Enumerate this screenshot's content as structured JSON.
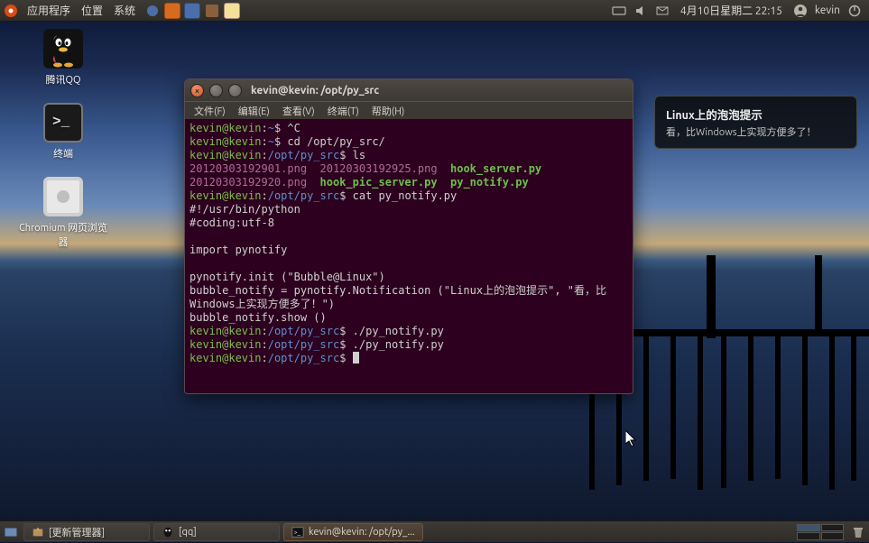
{
  "top_panel": {
    "menus": [
      "应用程序",
      "位置",
      "系统"
    ],
    "clock": "4月10日星期二 22:15",
    "user": "kevin"
  },
  "desktop_icons": {
    "qq": "腾讯QQ",
    "terminal": "终端",
    "chromium": "Chromium 网页浏览器"
  },
  "terminal": {
    "title": "kevin@kevin: /opt/py_src",
    "menus": [
      "文件(F)",
      "编辑(E)",
      "查看(V)",
      "终端(T)",
      "帮助(H)"
    ],
    "l1_user": "kevin@kevin",
    "l1_path": "~",
    "l1_cmd": "^C",
    "l2_cmd": "cd /opt/py_src/",
    "l3_path": "/opt/py_src",
    "l3_cmd": "ls",
    "ls_png1": "20120303192901.png",
    "ls_png2": "20120303192925.png",
    "ls_exe1": "hook_server.py",
    "ls_png3": "20120303192920.png",
    "ls_exe2": "hook_pic_server.py",
    "ls_exe3": "py_notify.py",
    "l4_cmd": "cat py_notify.py",
    "src1": "#!/usr/bin/python",
    "src2": "#coding:utf-8",
    "src3": "",
    "src4": "import pynotify",
    "src5": "",
    "src6": "pynotify.init (\"Bubble@Linux\")",
    "src7": "bubble_notify = pynotify.Notification (\"Linux上的泡泡提示\", \"看，比Windows上实现方便多了！\")",
    "src8": "bubble_notify.show ()",
    "l5_cmd": "./py_notify.py",
    "l6_cmd": "./py_notify.py"
  },
  "notification": {
    "title": "Linux上的泡泡提示",
    "body": "看，比Windows上实现方便多了！"
  },
  "bottom_panel": {
    "task1": "[更新管理器]",
    "task2": "[qq]",
    "task3": "kevin@kevin: /opt/py_..."
  }
}
